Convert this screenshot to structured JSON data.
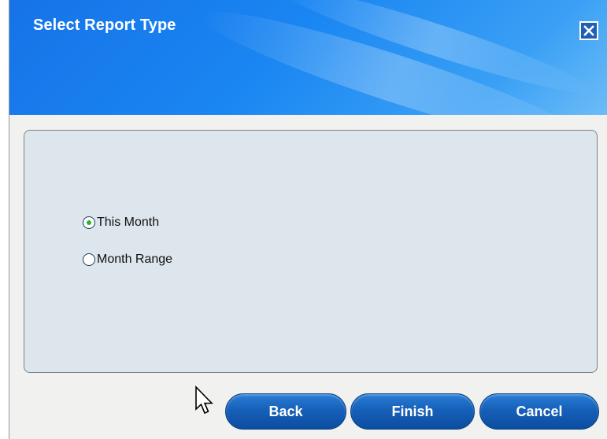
{
  "dialog": {
    "title": "Select Report Type",
    "close_icon": "close-icon"
  },
  "report_type": {
    "options": [
      {
        "label": "This Month",
        "selected": true
      },
      {
        "label": "Month Range",
        "selected": false
      }
    ]
  },
  "footer": {
    "back_label": "Back",
    "finish_label": "Finish",
    "cancel_label": "Cancel"
  },
  "colors": {
    "header_blue": "#1a86f2",
    "panel_bg": "#dce6ec",
    "button_blue": "#1660b9",
    "radio_selected": "#2fb12f"
  }
}
